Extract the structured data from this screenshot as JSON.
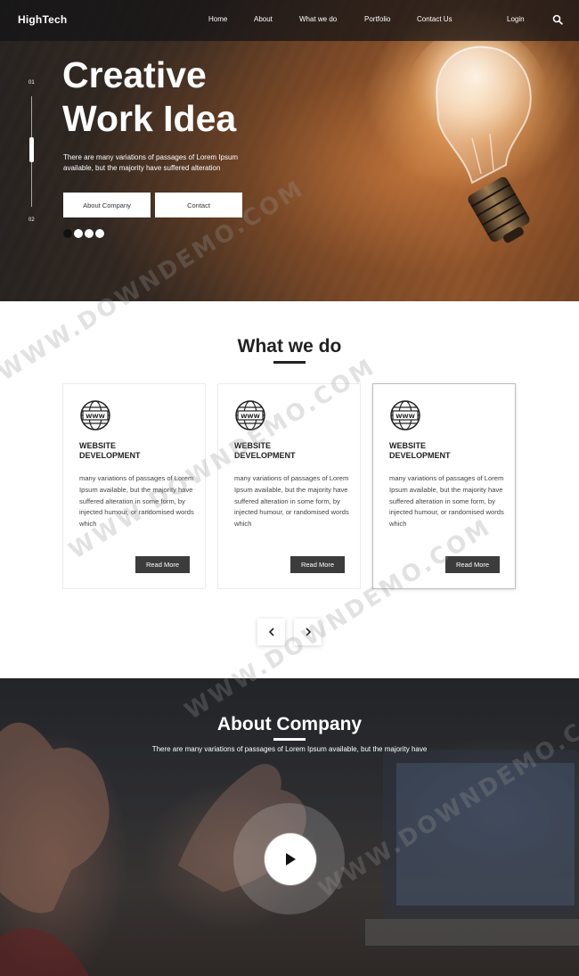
{
  "nav": {
    "logo": "HighTech",
    "links": [
      "Home",
      "About",
      "What we do",
      "Portfolio",
      "Contact Us"
    ],
    "login": "Login"
  },
  "hero": {
    "slide_start": "01",
    "slide_end": "02",
    "title_line1": "Creative",
    "title_line2": "Work Idea",
    "subtitle": "There are many variations of passages of Lorem Ipsum available, but the majority have suffered alteration",
    "btn_about": "About Company",
    "btn_contact": "Contact",
    "dots_total": 4,
    "dot_active": 1
  },
  "what_we_do": {
    "title": "What we do",
    "cards": [
      {
        "title_line1": "WEBSITE",
        "title_line2": "DEVELOPMENT",
        "text": "many variations of passages of Lorem Ipsum available, but the majority have suffered alteration in some form, by injected humour, or randomised words which",
        "button": "Read More"
      },
      {
        "title_line1": "WEBSITE",
        "title_line2": "DEVELOPMENT",
        "text": "many variations of passages of Lorem Ipsum available, but the majority have suffered alteration in some form, by injected humour, or randomised words which",
        "button": "Read More"
      },
      {
        "title_line1": "WEBSITE",
        "title_line2": "DEVELOPMENT",
        "text": "many variations of passages of Lorem Ipsum available, but the majority have suffered alteration in some form, by injected humour, or randomised words which",
        "button": "Read More"
      }
    ],
    "featured_card": 2
  },
  "about": {
    "title": "About Company",
    "subtitle": "There are many variations of passages of Lorem Ipsum available, but the majority have"
  },
  "icons": {
    "search": "search-icon",
    "globe": "globe-www-icon",
    "prev": "chevron-left-icon",
    "next": "chevron-right-icon",
    "play": "play-icon"
  },
  "watermark": "WWW.DOWNDEMO.COM",
  "colors": {
    "dark": "#222222",
    "button_dark": "#3c3c3c",
    "nav_bg": "#141416"
  }
}
